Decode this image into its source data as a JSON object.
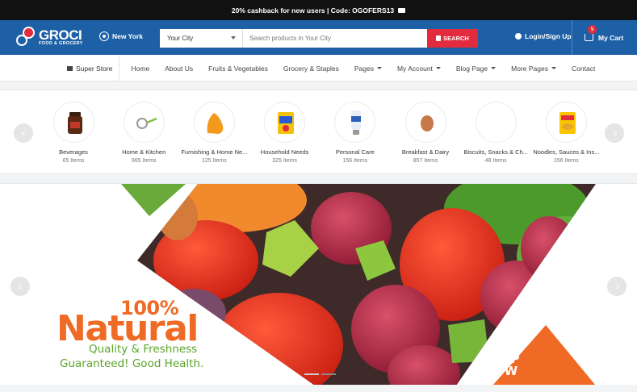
{
  "topbar": {
    "text": "20% cashback for new users | Code: OGOFERS13"
  },
  "header": {
    "logo_title": "GROCI",
    "logo_subtitle": "FOOD & GROCERY",
    "location": "New York",
    "city_select": "Your City",
    "search_placeholder": "Search products in Your City",
    "search_button": "SEARCH",
    "login": "Login/Sign Up",
    "cart_label": "My Cart",
    "cart_count": "5"
  },
  "nav": {
    "super_store": "Super Store",
    "items": [
      {
        "label": "Home",
        "dropdown": false
      },
      {
        "label": "About Us",
        "dropdown": false
      },
      {
        "label": "Fruits & Vegetables",
        "dropdown": false
      },
      {
        "label": "Grocery & Staples",
        "dropdown": false
      },
      {
        "label": "Pages",
        "dropdown": true
      },
      {
        "label": "My Account",
        "dropdown": true
      },
      {
        "label": "Blog Page",
        "dropdown": true
      },
      {
        "label": "More Pages",
        "dropdown": true
      },
      {
        "label": "Contact",
        "dropdown": false
      }
    ]
  },
  "categories": [
    {
      "name": "Beverages",
      "count": "65 Items",
      "icon": "coffee-jar-icon"
    },
    {
      "name": "Home & Kitchen",
      "count": "965 Items",
      "icon": "strainer-icon"
    },
    {
      "name": "Furnishing & Home Ne...",
      "count": "125 Items",
      "icon": "beanbag-icon"
    },
    {
      "name": "Household Needs",
      "count": "325 Items",
      "icon": "detergent-pack-icon"
    },
    {
      "name": "Personal Care",
      "count": "156 Items",
      "icon": "cream-tube-icon"
    },
    {
      "name": "Breakfast & Dairy",
      "count": "857 Items",
      "icon": "egg-icon"
    },
    {
      "name": "Biscuits, Snacks & Ch...",
      "count": "48 Items",
      "icon": "snacks-icon"
    },
    {
      "name": "Noodles, Sauces & Ins...",
      "count": "156 Items",
      "icon": "noodles-pack-icon"
    }
  ],
  "banner": {
    "percent": "100%",
    "headline": "Natural",
    "line1": "Quality & Freshness",
    "line2": "Guaranteed! Good Health.",
    "cta_line1": "SHOP",
    "cta_line2": "NOW"
  },
  "colors": {
    "header_bg": "#1d60a6",
    "accent_red": "#e22b3c",
    "orange": "#ef6b25",
    "green": "#5aa52a"
  }
}
